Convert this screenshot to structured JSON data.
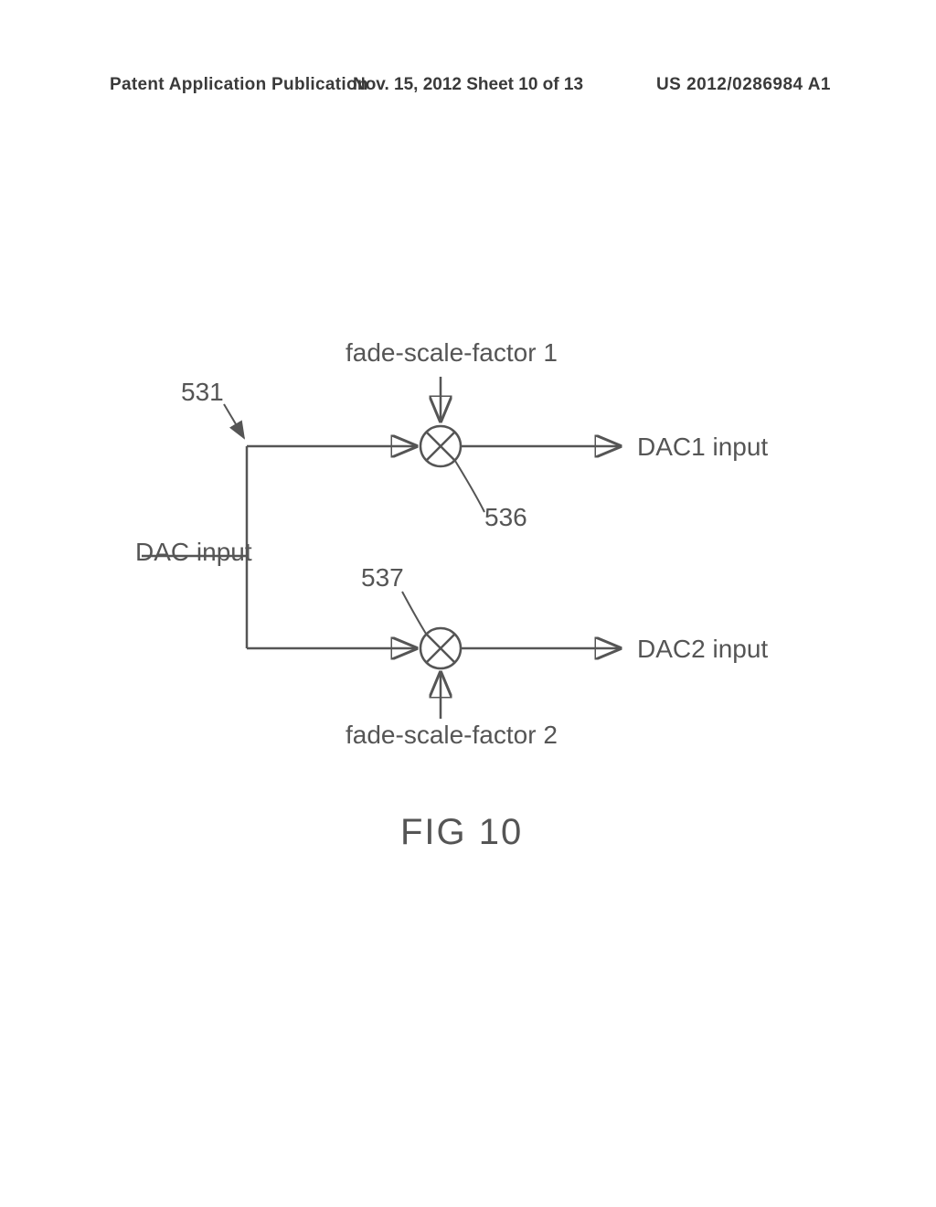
{
  "header": {
    "left": "Patent Application Publication",
    "center": "Nov. 15, 2012  Sheet 10 of 13",
    "right": "US 2012/0286984 A1"
  },
  "labels": {
    "fade_scale_1": "fade-scale-factor 1",
    "fade_scale_2": "fade-scale-factor 2",
    "dac_input": "DAC input",
    "dac1_input": "DAC1 input",
    "dac2_input": "DAC2 input",
    "ref_531": "531",
    "ref_536": "536",
    "ref_537": "537",
    "figure": "FIG 10"
  }
}
